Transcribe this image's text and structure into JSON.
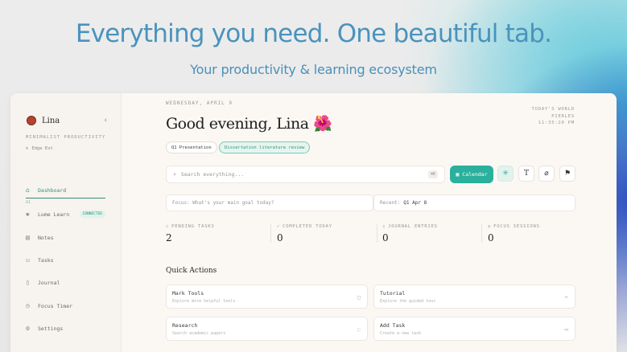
{
  "hero": {
    "title": "Everything you need. One beautiful tab.",
    "subtitle": "Your productivity & learning ecosystem"
  },
  "sidebar": {
    "user_name": "Lina",
    "collapse_icon": "chevron-left-icon",
    "tagline": "MINIMALIST PRODUCTIVITY",
    "edge_label": "Edge Ext",
    "ai_tag": "AI",
    "items": [
      {
        "label": "Dashboard",
        "icon": "home-icon",
        "active": true
      },
      {
        "label": "Lume Learn",
        "icon": "learn-icon",
        "badge": "CONNECTED"
      },
      {
        "label": "Notes",
        "icon": "notes-icon"
      },
      {
        "label": "Tasks",
        "icon": "tasks-icon"
      },
      {
        "label": "Journal",
        "icon": "journal-icon"
      },
      {
        "label": "Focus Timer",
        "icon": "timer-icon"
      },
      {
        "label": "Settings",
        "icon": "gear-icon"
      }
    ]
  },
  "header": {
    "date": "WEDNESDAY, APRIL 9",
    "greeting": "Good evening, Lina",
    "greeting_emoji": "🌺",
    "world_label": "TODAY'S WORLD",
    "location": "PIERLES",
    "time": "11:35:20 PM"
  },
  "chips": [
    {
      "label": "Q1 Presentation",
      "active": false
    },
    {
      "label": "Dissertation literature review",
      "active": true
    }
  ],
  "search": {
    "placeholder": "Search everything...",
    "shortcut": "⌘K"
  },
  "toolbar": {
    "calendar_label": "Calendar"
  },
  "focus": {
    "placeholder": "Focus: What's your main goal today?",
    "recent_label": "Recent:",
    "recent_value": "Q1 Apr 8"
  },
  "stats": [
    {
      "label": "PENDING TASKS",
      "value": "2"
    },
    {
      "label": "COMPLETED TODAY",
      "value": "0"
    },
    {
      "label": "JOURNAL ENTRIES",
      "value": "0"
    },
    {
      "label": "FOCUS SESSIONS",
      "value": "0"
    }
  ],
  "quick_actions": {
    "title": "Quick Actions",
    "items": [
      {
        "title": "Mark Tools",
        "desc": "Explore more helpful tools"
      },
      {
        "title": "Tutorial",
        "desc": "Explore the guided tour"
      },
      {
        "title": "Research",
        "desc": "Search academic papers"
      },
      {
        "title": "Add Task",
        "desc": "Create a new task"
      }
    ]
  },
  "colors": {
    "accent": "#2ab09c",
    "hero_text": "#4a93bd"
  }
}
